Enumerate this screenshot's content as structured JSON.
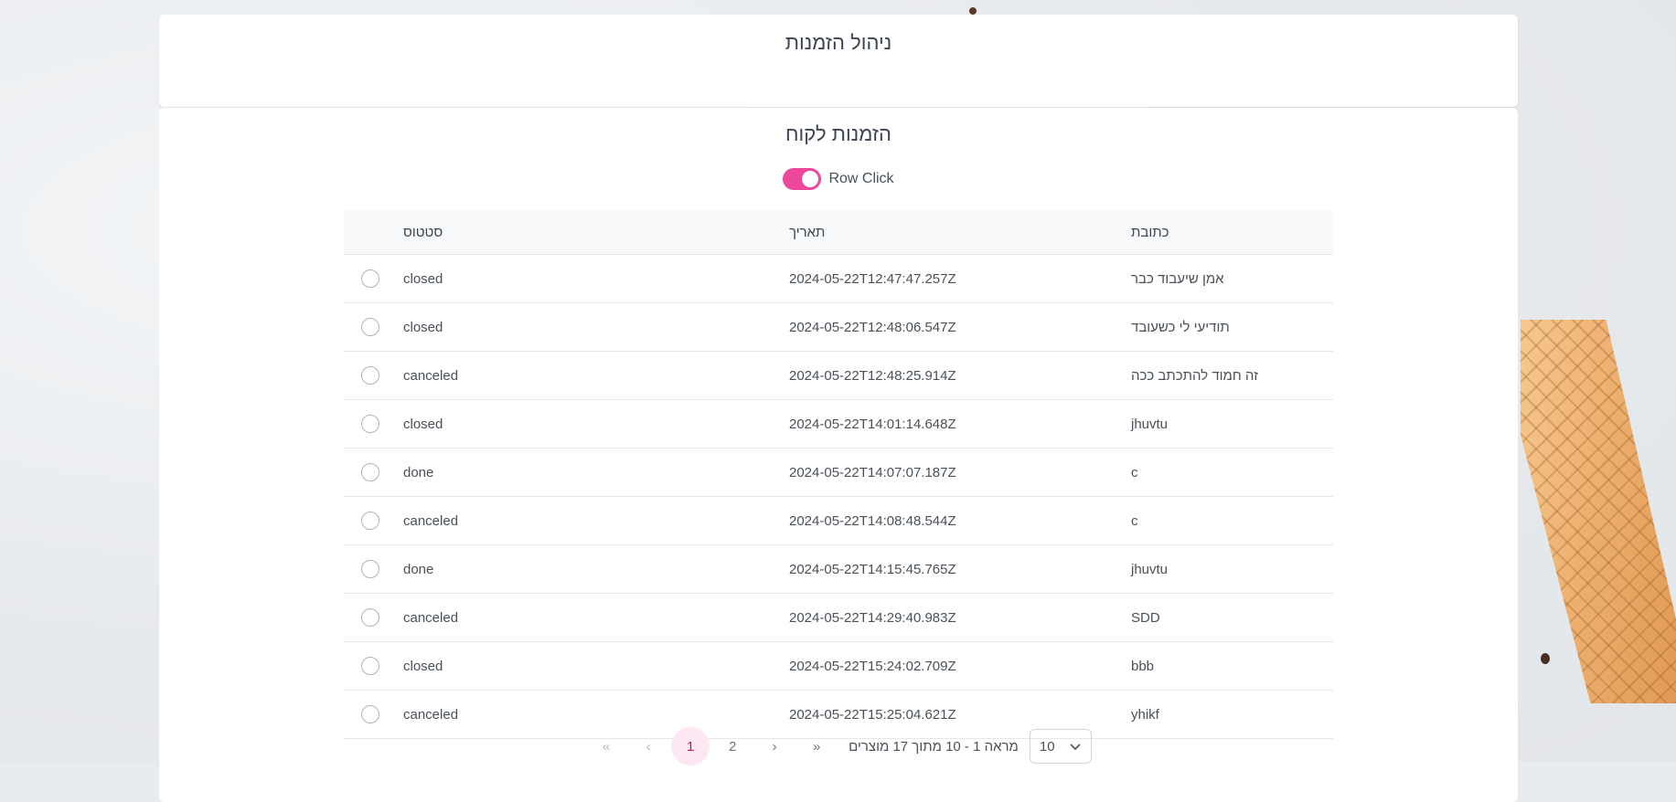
{
  "header": {
    "title": "ניהול הזמנות"
  },
  "panel": {
    "title": "הזמנות לקוח",
    "toggle_label": "Row Click",
    "toggle_on": true
  },
  "table": {
    "columns": {
      "status": "סטטוס",
      "date": "תאריך",
      "address": "כתובת"
    },
    "rows": [
      {
        "status": "closed",
        "date": "2024-05-22T12:47:47.257Z",
        "address": "אמן שיעבוד כבר"
      },
      {
        "status": "closed",
        "date": "2024-05-22T12:48:06.547Z",
        "address": "תודיעי לי כשעובד"
      },
      {
        "status": "canceled",
        "date": "2024-05-22T12:48:25.914Z",
        "address": "זה חמוד להתכתב ככה"
      },
      {
        "status": "closed",
        "date": "2024-05-22T14:01:14.648Z",
        "address": "jhuvtu"
      },
      {
        "status": "done",
        "date": "2024-05-22T14:07:07.187Z",
        "address": "c"
      },
      {
        "status": "canceled",
        "date": "2024-05-22T14:08:48.544Z",
        "address": "c"
      },
      {
        "status": "done",
        "date": "2024-05-22T14:15:45.765Z",
        "address": "jhuvtu"
      },
      {
        "status": "canceled",
        "date": "2024-05-22T14:29:40.983Z",
        "address": "SDD"
      },
      {
        "status": "closed",
        "date": "2024-05-22T15:24:02.709Z",
        "address": "bbb"
      },
      {
        "status": "canceled",
        "date": "2024-05-22T15:25:04.621Z",
        "address": "yhikf"
      }
    ]
  },
  "pagination": {
    "first_icon": "«",
    "prev_icon": "‹",
    "pages": [
      "1",
      "2"
    ],
    "active_page": "1",
    "next_icon": "›",
    "last_icon": "»",
    "info": "מראה 1 - 10 מתוך 17 מוצרים",
    "page_size": "10",
    "dropdown_icon": "chevron-down-icon"
  },
  "colors": {
    "accent": "#ec4899",
    "active_page_bg": "#fce7f3"
  }
}
